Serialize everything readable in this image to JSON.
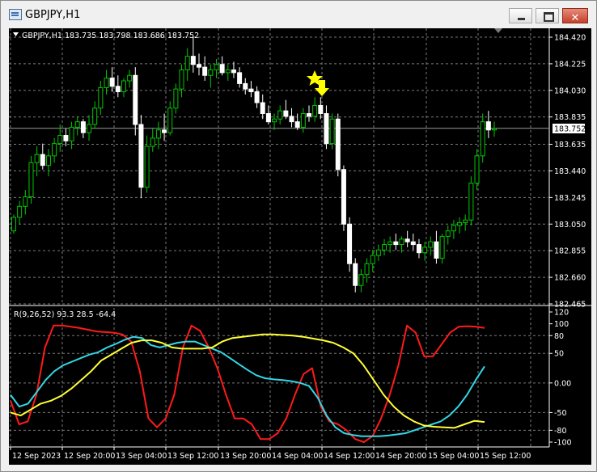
{
  "window": {
    "title": "GBPJPY,H1",
    "close_glyph": "✕"
  },
  "colors": {
    "background": "#000000",
    "grid": "#7a7a7a",
    "bull": "#00c800",
    "bear": "#ffffff",
    "red_line": "#ff1a1a",
    "cyan_line": "#33d6e6",
    "yellow_line": "#ffff33",
    "signal": "#ffff00",
    "axis_text": "#ffffff"
  },
  "chart_data": [
    {
      "type": "candlestick",
      "symbol_line": "GBPJPY,H1  183.735 183.798 183.686 183.752",
      "current_price_label": "183.752",
      "y_ticks": [
        "184.420",
        "184.225",
        "184.030",
        "183.835",
        "183.635",
        "183.440",
        "183.245",
        "183.050",
        "182.855",
        "182.660",
        "182.465"
      ],
      "ylim": [
        182.465,
        184.42
      ],
      "x_ticks": [
        "12 Sep 2023",
        "12 Sep 20:00",
        "13 Sep 04:00",
        "13 Sep 12:00",
        "13 Sep 20:00",
        "14 Sep 04:00",
        "14 Sep 12:00",
        "14 Sep 20:00",
        "15 Sep 04:00",
        "15 Sep 12:00"
      ],
      "icons": [
        "star-icon",
        "down-arrow-icon"
      ]
    },
    {
      "type": "line",
      "indicator_label": "R(9,26,52) 93.3 28.5 -64.4",
      "y_ticks": [
        "120",
        "100",
        "80",
        "50",
        "0.00",
        "-50",
        "-80",
        "-100"
      ],
      "ylim": [
        -100,
        120
      ],
      "series_values": [
        93.3,
        28.5,
        -64.4
      ]
    }
  ]
}
